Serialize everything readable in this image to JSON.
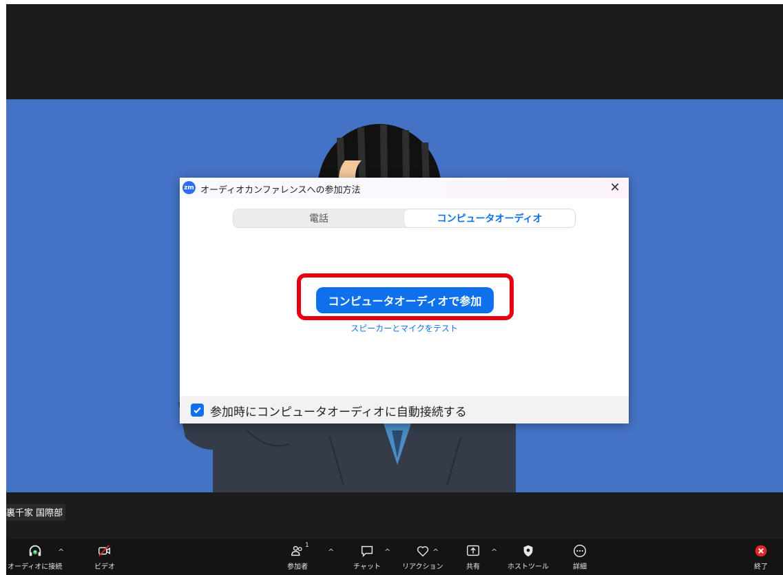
{
  "participant_name": "裏千家 国際部",
  "dialog": {
    "title": "オーディオカンファレンスへの参加方法",
    "logo_text": "zm",
    "close_glyph": "✕",
    "tabs": [
      {
        "label": "電話",
        "active": false
      },
      {
        "label": "コンピュータオーディオ",
        "active": true
      }
    ],
    "join_button": "コンピュータオーディオで参加",
    "test_link": "スピーカーとマイクをテスト",
    "auto_connect_label": "参加時にコンピュータオーディオに自動接続する",
    "auto_connect_checked": true
  },
  "toolbar": {
    "audio": {
      "label": "オーディオに接続",
      "icon": "headphones-icon"
    },
    "video": {
      "label": "ビデオ",
      "icon": "video-off-icon"
    },
    "participants": {
      "label": "参加者",
      "count": "1",
      "icon": "participants-icon"
    },
    "chat": {
      "label": "チャット",
      "icon": "chat-icon"
    },
    "reactions": {
      "label": "リアクション",
      "icon": "heart-icon"
    },
    "share": {
      "label": "共有",
      "icon": "share-icon"
    },
    "host_tools": {
      "label": "ホストツール",
      "icon": "shield-icon"
    },
    "more": {
      "label": "詳細",
      "icon": "more-icon"
    },
    "end": {
      "label": "終了",
      "icon": "end-icon"
    }
  },
  "colors": {
    "accent": "#0e71eb",
    "highlight": "#e60012",
    "video_bg": "#4472c4",
    "toolbar_bg": "#141414",
    "end_red": "#e02828"
  }
}
